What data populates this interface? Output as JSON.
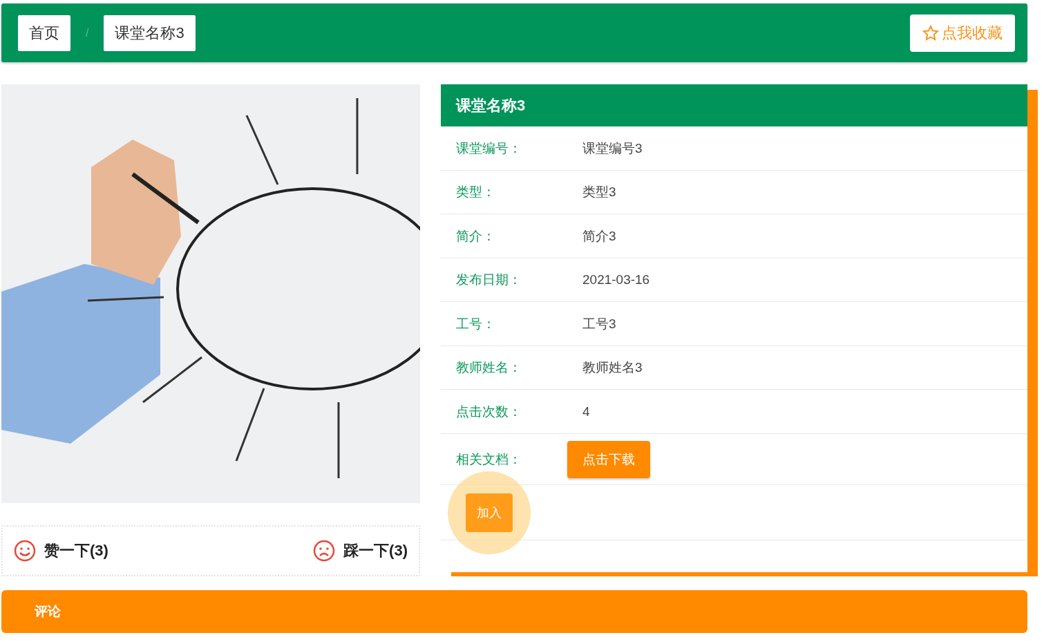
{
  "breadcrumb": [
    {
      "label": "首页"
    },
    {
      "label": "课堂名称3"
    }
  ],
  "separator": "/",
  "favorite_button": {
    "label": "点我收藏"
  },
  "votes": [
    {
      "kind": "like",
      "label": "赞一下(3)"
    },
    {
      "kind": "dislike",
      "label": "踩一下(3)"
    }
  ],
  "details": {
    "title": "课堂名称3",
    "fields": [
      {
        "label": "课堂编号：",
        "value": "课堂编号3"
      },
      {
        "label": "类型：",
        "value": "类型3"
      },
      {
        "label": "简介：",
        "value": "简介3"
      },
      {
        "label": "发布日期：",
        "value": "2021-03-16"
      },
      {
        "label": "工号：",
        "value": "工号3"
      },
      {
        "label": "教师姓名：",
        "value": "教师姓名3"
      },
      {
        "label": "点击次数：",
        "value": "4"
      }
    ],
    "document": {
      "label": "相关文档：",
      "button": "点击下载"
    },
    "join_button": "加入"
  },
  "comments": {
    "title": "评论"
  }
}
